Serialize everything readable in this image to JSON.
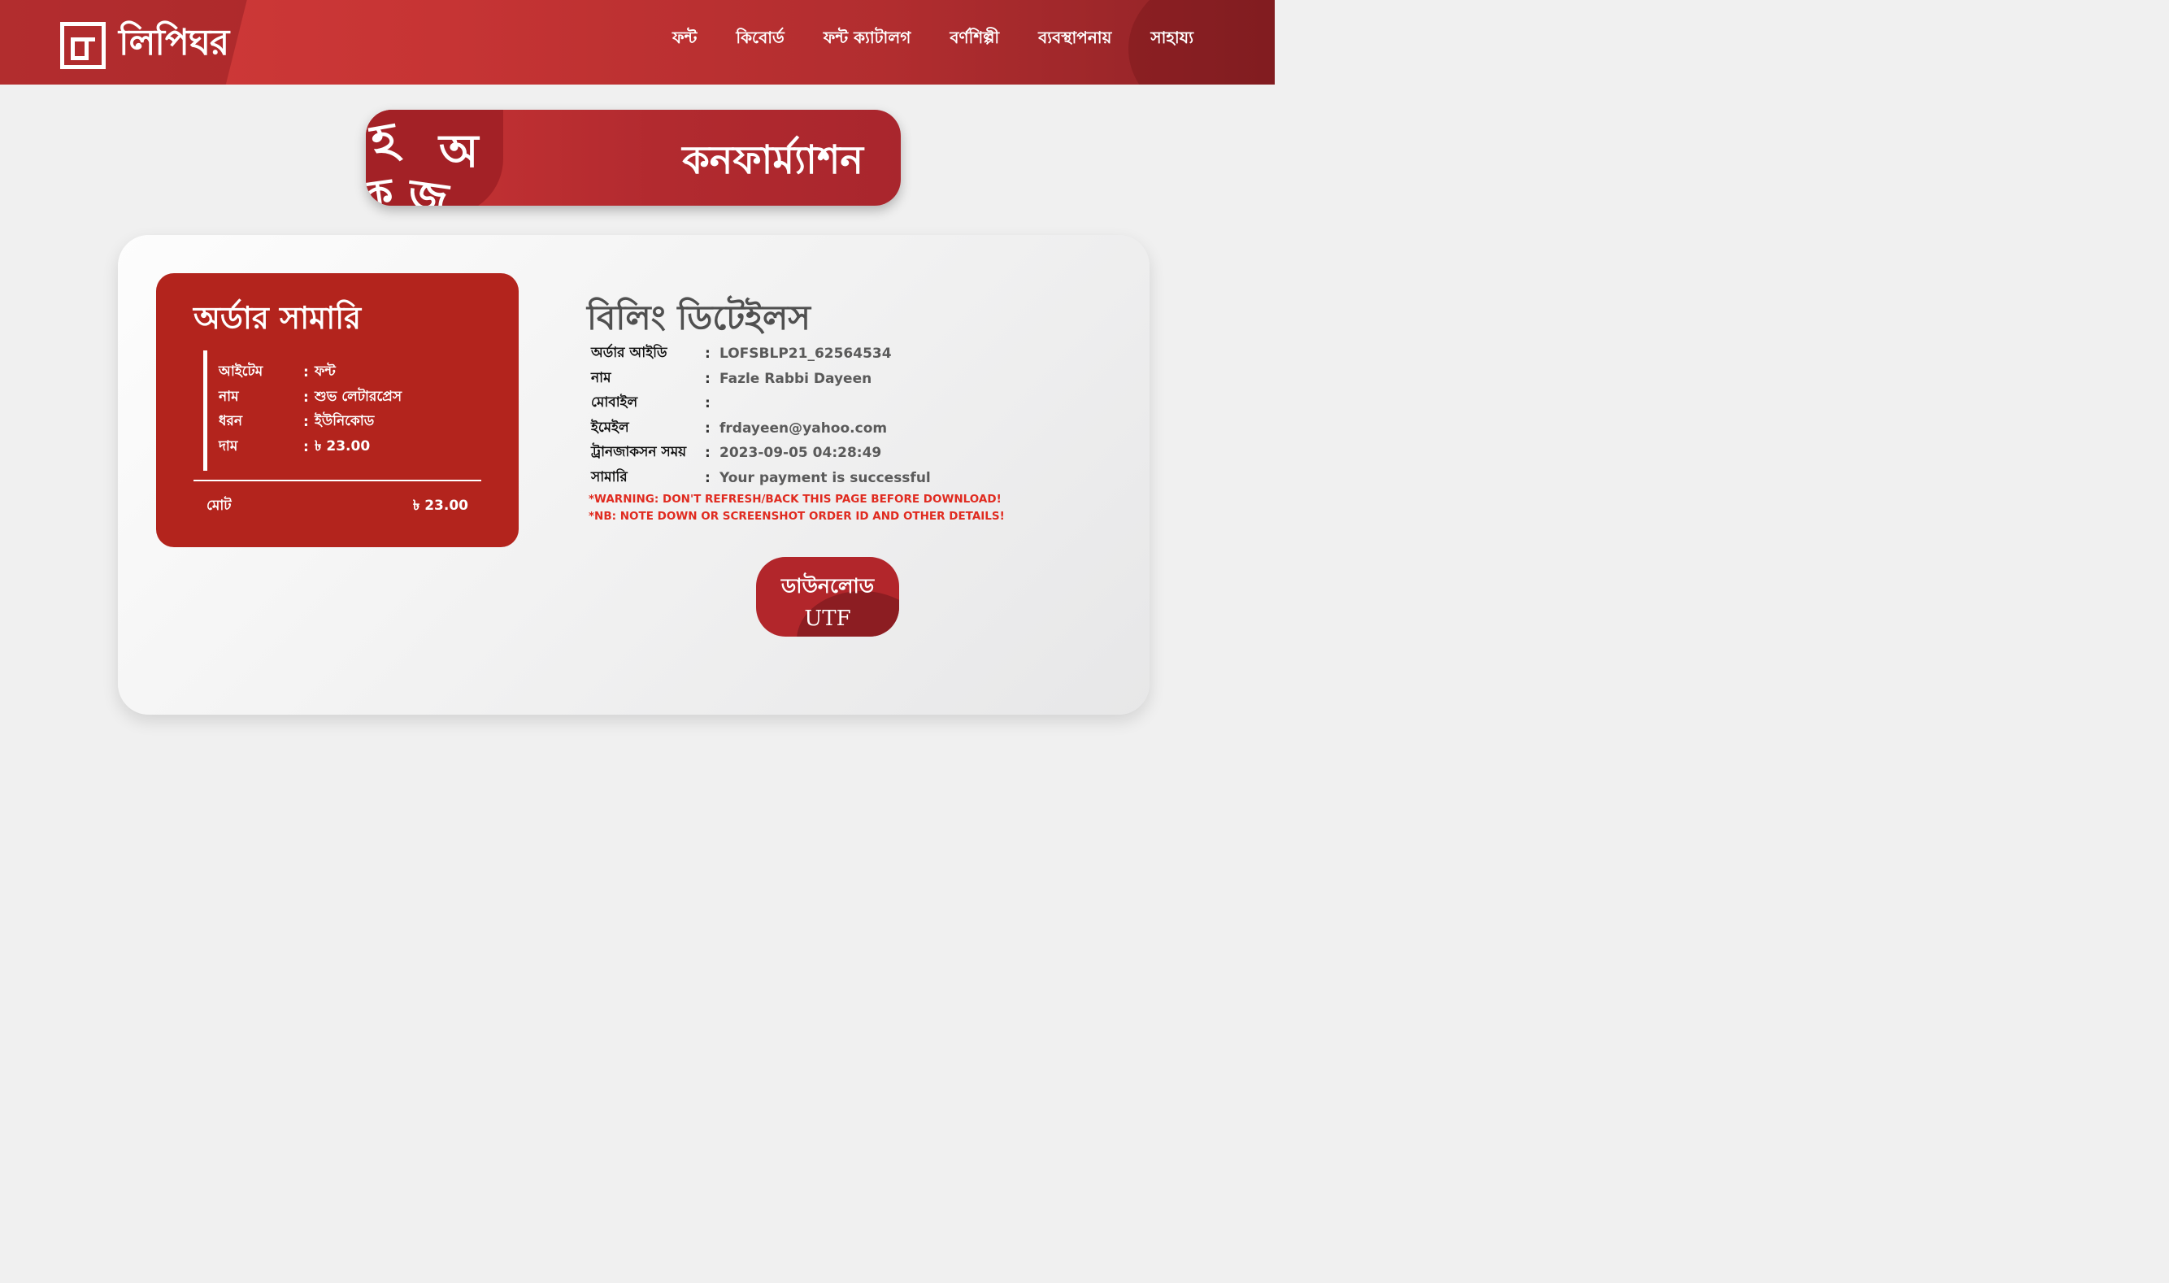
{
  "header": {
    "logo_text": "লিপিঘর",
    "nav": [
      "ফন্ট",
      "কিবোর্ড",
      "ফন্ট ক্যাটালগ",
      "বর্ণশিল্পী",
      "ব্যবস্থাপনায়",
      "সাহায্য"
    ]
  },
  "banner": {
    "title": "কনফার্ম্যাশন",
    "deco_letters": [
      "অ",
      "ক",
      "জ",
      "হ"
    ]
  },
  "summary": {
    "title": "অর্ডার সামারি",
    "rows": [
      {
        "key": "আইটেম",
        "value": "ফন্ট"
      },
      {
        "key": "নাম",
        "value": "শুভ লেটারপ্রেস"
      },
      {
        "key": "ধরন",
        "value": "ইউনিকোড"
      },
      {
        "key": "দাম",
        "value": "৳ 23.00"
      }
    ],
    "total_label": "মোট",
    "total_value": "৳ 23.00"
  },
  "billing": {
    "title": "বিলিং ডিটেইলস",
    "rows": [
      {
        "key": "অর্ডার আইডি",
        "value": "LOFSBLP21_62564534"
      },
      {
        "key": "নাম",
        "value": "Fazle Rabbi Dayeen"
      },
      {
        "key": "মোবাইল",
        "value": ""
      },
      {
        "key": "ইমেইল",
        "value": "frdayeen@yahoo.com"
      },
      {
        "key": "ট্রানজাকসন সময়",
        "value": "2023-09-05 04:28:49"
      },
      {
        "key": "সামারি",
        "value": "Your payment is successful"
      }
    ],
    "separator": ":",
    "warning": "*WARNING: DON'T REFRESH/BACK THIS PAGE BEFORE DOWNLOAD!",
    "note": "*NB: NOTE DOWN OR SCREENSHOT ORDER ID AND OTHER DETAILS!"
  },
  "download": {
    "line1": "ডাউনলোড",
    "line2": "UTF"
  },
  "colors": {
    "brand_red": "#b3241d",
    "warning_red": "#e02b20",
    "page_bg": "#f0f0f0"
  }
}
